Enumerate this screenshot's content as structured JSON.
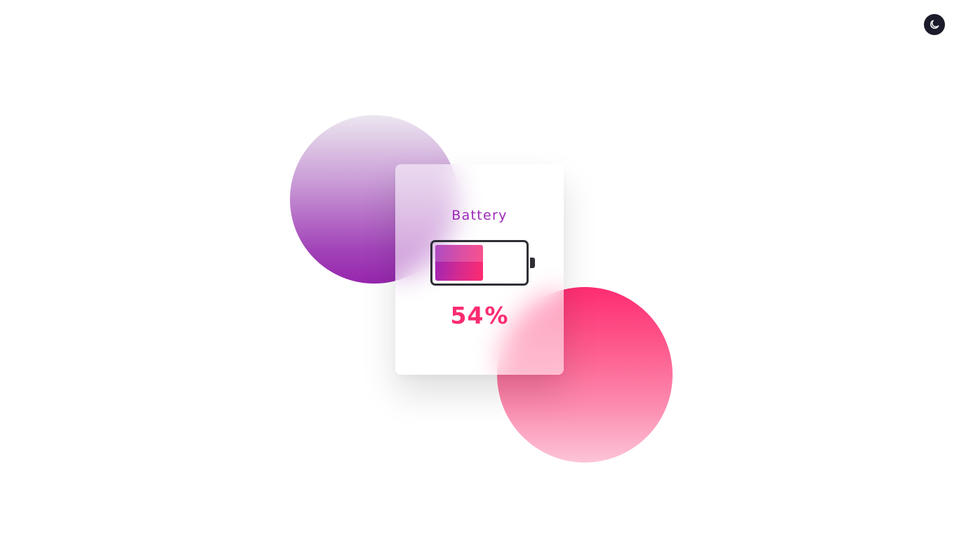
{
  "app": {
    "theme_toggle_icon": "moon-icon"
  },
  "widget": {
    "title": "Battery",
    "level_percent": 54,
    "level_text": "54",
    "percent_sign": "%",
    "accent_color": "#9b27b6",
    "percent_color": "#fb2c70",
    "fill_gradient": [
      "#9a25b6",
      "#fe2b70"
    ]
  },
  "decor": {
    "purple_circle_colors": [
      "#ece6f0",
      "#9626ad"
    ],
    "pink_circle_colors": [
      "#fe2c72",
      "#fcc4d7"
    ]
  }
}
